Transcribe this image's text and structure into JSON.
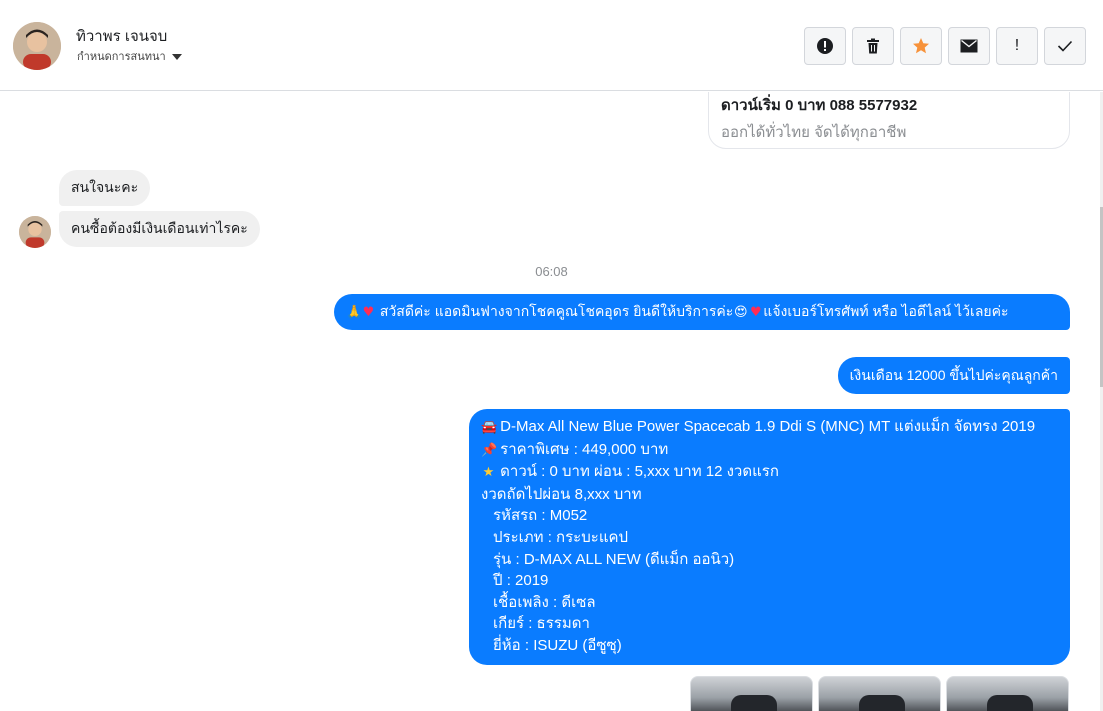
{
  "header": {
    "contact_name": "ทิวาพร เจนจบ",
    "subtitle": "กำหนดการสนทนา",
    "actions": [
      {
        "name": "report-button",
        "icon": "exclamation-circle-icon",
        "color": "#1c1e21"
      },
      {
        "name": "delete-button",
        "icon": "trash-icon",
        "color": "#1c1e21"
      },
      {
        "name": "star-button",
        "icon": "star-icon",
        "color": "#f7923a"
      },
      {
        "name": "mail-button",
        "icon": "envelope-icon",
        "color": "#1c1e21"
      },
      {
        "name": "mark-important-button",
        "icon": "exclamation-icon",
        "label": "!",
        "color": "#1c1e21"
      },
      {
        "name": "done-button",
        "icon": "check-icon",
        "color": "#1c1e21"
      }
    ]
  },
  "thread": {
    "card": {
      "line1": "ดาวน์เริ่ม 0 บาท 088 5577932",
      "line2": "ออกได้ทั่วไทย จัดได้ทุกอาชีพ"
    },
    "incoming": [
      "สนใจนะคะ",
      "คนซื้อต้องมีเงินเดือนเท่าไรคะ"
    ],
    "timestamp": "06:08",
    "outgoing_1": {
      "text_a": "สวัสดีค่ะ แอดมินฟางจากโชคคูณโชคอุดร ยินดีให้บริการค่ะ",
      "text_b": "แจ้งเบอร์โทรศัพท์ หรือ ไอดีไลน์  ไว้เลยค่ะ"
    },
    "outgoing_2": "เงินเดือน 12000 ขึ้นไปค่ะคุณลูกค้า",
    "listing": {
      "title": "D-Max All New Blue Power Spacecab 1.9 Ddi S (MNC) MT แต่งแม็ก จัดทรง 2019",
      "price": "ราคาพิเศษ : 449,000 บาท",
      "down": "ดาวน์ : 0 บาท ผ่อน : 5,xxx บาท 12 งวดแรก",
      "next": "งวดถัดไปผ่อน  8,xxx  บาท",
      "code": "รหัสรถ : M052",
      "type": "ประเภท : กระบะแคป",
      "model": "รุ่น : D-MAX ALL NEW (ดีแม็ก ออนิว)",
      "year": "ปี : 2019",
      "fuel": "เชื้อเพลิง : ดีเซล",
      "gear": "เกียร์ : ธรรมดา",
      "brand": "ยี่ห้อ : ISUZU (อีซูซุ)"
    }
  },
  "colors": {
    "outgoing_bubble": "#0a7cff",
    "incoming_bubble": "#f0f0f0",
    "star_accent": "#f7923a"
  }
}
